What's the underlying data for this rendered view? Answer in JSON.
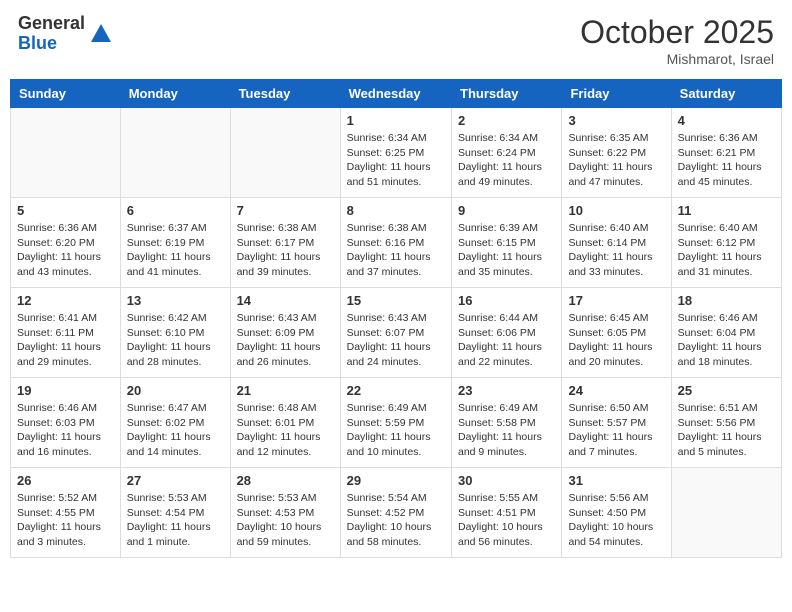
{
  "header": {
    "logo_general": "General",
    "logo_blue": "Blue",
    "month_title": "October 2025",
    "location": "Mishmarot, Israel"
  },
  "days_of_week": [
    "Sunday",
    "Monday",
    "Tuesday",
    "Wednesday",
    "Thursday",
    "Friday",
    "Saturday"
  ],
  "weeks": [
    [
      {
        "day": "",
        "info": ""
      },
      {
        "day": "",
        "info": ""
      },
      {
        "day": "",
        "info": ""
      },
      {
        "day": "1",
        "info": "Sunrise: 6:34 AM\nSunset: 6:25 PM\nDaylight: 11 hours\nand 51 minutes."
      },
      {
        "day": "2",
        "info": "Sunrise: 6:34 AM\nSunset: 6:24 PM\nDaylight: 11 hours\nand 49 minutes."
      },
      {
        "day": "3",
        "info": "Sunrise: 6:35 AM\nSunset: 6:22 PM\nDaylight: 11 hours\nand 47 minutes."
      },
      {
        "day": "4",
        "info": "Sunrise: 6:36 AM\nSunset: 6:21 PM\nDaylight: 11 hours\nand 45 minutes."
      }
    ],
    [
      {
        "day": "5",
        "info": "Sunrise: 6:36 AM\nSunset: 6:20 PM\nDaylight: 11 hours\nand 43 minutes."
      },
      {
        "day": "6",
        "info": "Sunrise: 6:37 AM\nSunset: 6:19 PM\nDaylight: 11 hours\nand 41 minutes."
      },
      {
        "day": "7",
        "info": "Sunrise: 6:38 AM\nSunset: 6:17 PM\nDaylight: 11 hours\nand 39 minutes."
      },
      {
        "day": "8",
        "info": "Sunrise: 6:38 AM\nSunset: 6:16 PM\nDaylight: 11 hours\nand 37 minutes."
      },
      {
        "day": "9",
        "info": "Sunrise: 6:39 AM\nSunset: 6:15 PM\nDaylight: 11 hours\nand 35 minutes."
      },
      {
        "day": "10",
        "info": "Sunrise: 6:40 AM\nSunset: 6:14 PM\nDaylight: 11 hours\nand 33 minutes."
      },
      {
        "day": "11",
        "info": "Sunrise: 6:40 AM\nSunset: 6:12 PM\nDaylight: 11 hours\nand 31 minutes."
      }
    ],
    [
      {
        "day": "12",
        "info": "Sunrise: 6:41 AM\nSunset: 6:11 PM\nDaylight: 11 hours\nand 29 minutes."
      },
      {
        "day": "13",
        "info": "Sunrise: 6:42 AM\nSunset: 6:10 PM\nDaylight: 11 hours\nand 28 minutes."
      },
      {
        "day": "14",
        "info": "Sunrise: 6:43 AM\nSunset: 6:09 PM\nDaylight: 11 hours\nand 26 minutes."
      },
      {
        "day": "15",
        "info": "Sunrise: 6:43 AM\nSunset: 6:07 PM\nDaylight: 11 hours\nand 24 minutes."
      },
      {
        "day": "16",
        "info": "Sunrise: 6:44 AM\nSunset: 6:06 PM\nDaylight: 11 hours\nand 22 minutes."
      },
      {
        "day": "17",
        "info": "Sunrise: 6:45 AM\nSunset: 6:05 PM\nDaylight: 11 hours\nand 20 minutes."
      },
      {
        "day": "18",
        "info": "Sunrise: 6:46 AM\nSunset: 6:04 PM\nDaylight: 11 hours\nand 18 minutes."
      }
    ],
    [
      {
        "day": "19",
        "info": "Sunrise: 6:46 AM\nSunset: 6:03 PM\nDaylight: 11 hours\nand 16 minutes."
      },
      {
        "day": "20",
        "info": "Sunrise: 6:47 AM\nSunset: 6:02 PM\nDaylight: 11 hours\nand 14 minutes."
      },
      {
        "day": "21",
        "info": "Sunrise: 6:48 AM\nSunset: 6:01 PM\nDaylight: 11 hours\nand 12 minutes."
      },
      {
        "day": "22",
        "info": "Sunrise: 6:49 AM\nSunset: 5:59 PM\nDaylight: 11 hours\nand 10 minutes."
      },
      {
        "day": "23",
        "info": "Sunrise: 6:49 AM\nSunset: 5:58 PM\nDaylight: 11 hours\nand 9 minutes."
      },
      {
        "day": "24",
        "info": "Sunrise: 6:50 AM\nSunset: 5:57 PM\nDaylight: 11 hours\nand 7 minutes."
      },
      {
        "day": "25",
        "info": "Sunrise: 6:51 AM\nSunset: 5:56 PM\nDaylight: 11 hours\nand 5 minutes."
      }
    ],
    [
      {
        "day": "26",
        "info": "Sunrise: 5:52 AM\nSunset: 4:55 PM\nDaylight: 11 hours\nand 3 minutes."
      },
      {
        "day": "27",
        "info": "Sunrise: 5:53 AM\nSunset: 4:54 PM\nDaylight: 11 hours\nand 1 minute."
      },
      {
        "day": "28",
        "info": "Sunrise: 5:53 AM\nSunset: 4:53 PM\nDaylight: 10 hours\nand 59 minutes."
      },
      {
        "day": "29",
        "info": "Sunrise: 5:54 AM\nSunset: 4:52 PM\nDaylight: 10 hours\nand 58 minutes."
      },
      {
        "day": "30",
        "info": "Sunrise: 5:55 AM\nSunset: 4:51 PM\nDaylight: 10 hours\nand 56 minutes."
      },
      {
        "day": "31",
        "info": "Sunrise: 5:56 AM\nSunset: 4:50 PM\nDaylight: 10 hours\nand 54 minutes."
      },
      {
        "day": "",
        "info": ""
      }
    ]
  ]
}
